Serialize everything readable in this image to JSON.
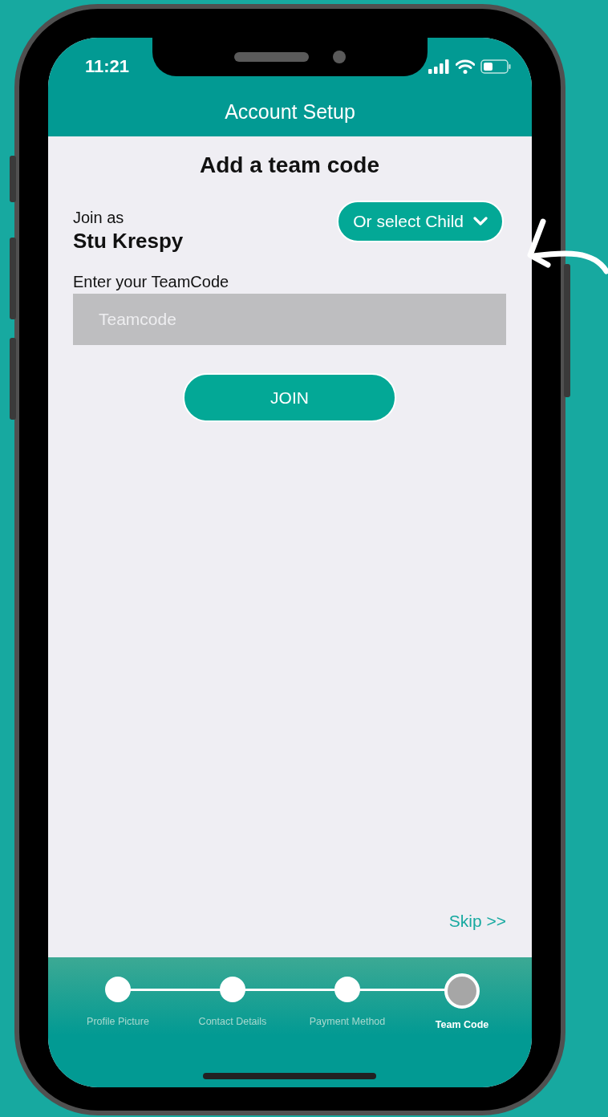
{
  "status_bar": {
    "time": "11:21"
  },
  "header": {
    "title": "Account Setup"
  },
  "heading": "Add a team code",
  "join": {
    "label": "Join as",
    "name": "Stu Krespy",
    "child_button": "Or select Child"
  },
  "teamcode": {
    "label": "Enter your TeamCode",
    "placeholder": "Teamcode"
  },
  "join_button": "JOIN",
  "skip": "Skip >>",
  "steps": [
    {
      "label": "Profile Picture",
      "selected": false
    },
    {
      "label": "Contact Details",
      "selected": false
    },
    {
      "label": "Payment Method",
      "selected": false
    },
    {
      "label": "Team Code",
      "selected": true
    }
  ]
}
